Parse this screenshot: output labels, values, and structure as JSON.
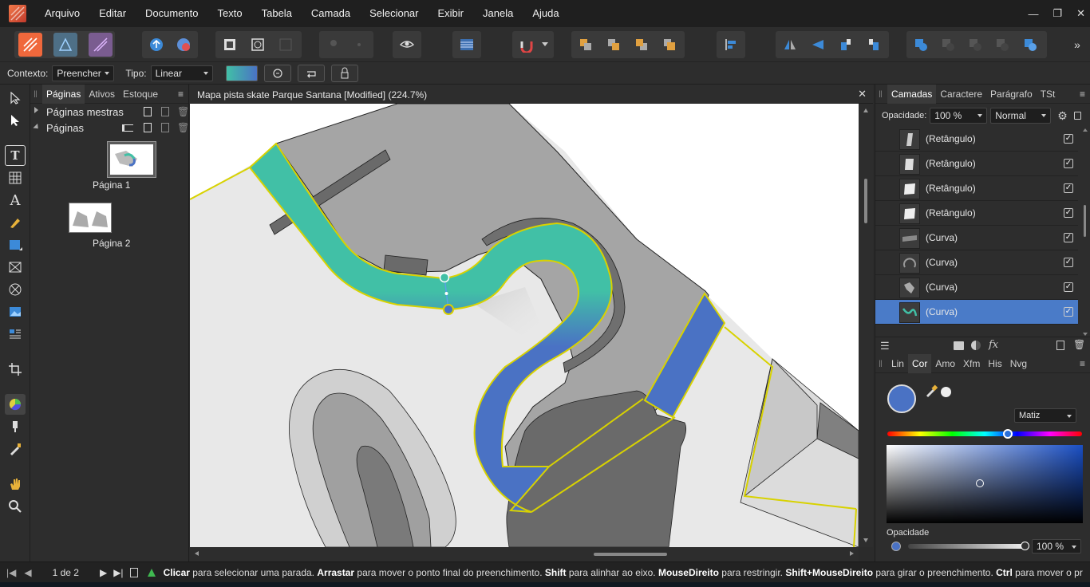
{
  "colors": {
    "accent": "#3c8ad8",
    "layer_selected": "#4a7bc8",
    "gradient_start": "#41c0a6",
    "gradient_end": "#4a72c4",
    "outline_yellow": "#d8d200",
    "picked_color": "#4a72c4"
  },
  "menu": {
    "items": [
      "Arquivo",
      "Editar",
      "Documento",
      "Texto",
      "Tabela",
      "Camada",
      "Selecionar",
      "Exibir",
      "Janela",
      "Ajuda"
    ]
  },
  "context_bar": {
    "context_label": "Contexto:",
    "context_value": "Preencher",
    "type_label": "Tipo:",
    "type_value": "Linear"
  },
  "pages_panel": {
    "tabs": [
      "Páginas",
      "Ativos",
      "Estoque"
    ],
    "master_pages_label": "Páginas mestras",
    "pages_label": "Páginas",
    "pages": [
      {
        "label": "Página 1",
        "selected": true
      },
      {
        "label": "Página 2",
        "selected": false
      }
    ]
  },
  "document": {
    "title": "Mapa pista skate Parque Santana [Modified] (224.7%)"
  },
  "layers_panel": {
    "tabs": [
      "Camadas",
      "Caractere",
      "Parágrafo",
      "TSt"
    ],
    "opacity_label": "Opacidade:",
    "opacity_value": "100 %",
    "blend_mode": "Normal",
    "layers": [
      {
        "name": "(Retângulo)",
        "thumb": "rect-thin-icon",
        "selected": false,
        "checked": "✓"
      },
      {
        "name": "(Retângulo)",
        "thumb": "rect-tilted-icon",
        "selected": false,
        "checked": "✓"
      },
      {
        "name": "(Retângulo)",
        "thumb": "rect-square-icon",
        "selected": false,
        "checked": "✓"
      },
      {
        "name": "(Retângulo)",
        "thumb": "rect-square-icon",
        "selected": false,
        "checked": "✓"
      },
      {
        "name": "(Curva)",
        "thumb": "curve-bar-icon",
        "selected": false,
        "checked": "✓"
      },
      {
        "name": "(Curva)",
        "thumb": "curve-arc-icon",
        "selected": false,
        "checked": "✓"
      },
      {
        "name": "(Curva)",
        "thumb": "curve-shape-icon",
        "selected": false,
        "checked": "✓"
      },
      {
        "name": "(Curva)",
        "thumb": "curve-teal-icon",
        "selected": true,
        "checked": "✓"
      }
    ]
  },
  "color_panel": {
    "tabs": [
      "Lin",
      "Cor",
      "Amo",
      "Xfm",
      "His",
      "Nvg"
    ],
    "mode_value": "Matiz",
    "hue_fraction": 0.62,
    "opacity_label": "Opacidade",
    "opacity_value": "100 %"
  },
  "status": {
    "page_indicator": "1 de 2",
    "hint_parts": [
      {
        "text": "Clicar",
        "bold": true
      },
      {
        "text": " para selecionar uma parada. ",
        "bold": false
      },
      {
        "text": "Arrastar",
        "bold": true
      },
      {
        "text": " para mover o ponto final do preenchimento. ",
        "bold": false
      },
      {
        "text": "Shift",
        "bold": true
      },
      {
        "text": " para alinhar ao eixo. ",
        "bold": false
      },
      {
        "text": "MouseDireito",
        "bold": true
      },
      {
        "text": " para restringir. ",
        "bold": false
      },
      {
        "text": "Shift+MouseDireito",
        "bold": true
      },
      {
        "text": " para girar o preenchimento. ",
        "bold": false
      },
      {
        "text": "Ctrl",
        "bold": true
      },
      {
        "text": " para mover o pr",
        "bold": false
      }
    ]
  }
}
